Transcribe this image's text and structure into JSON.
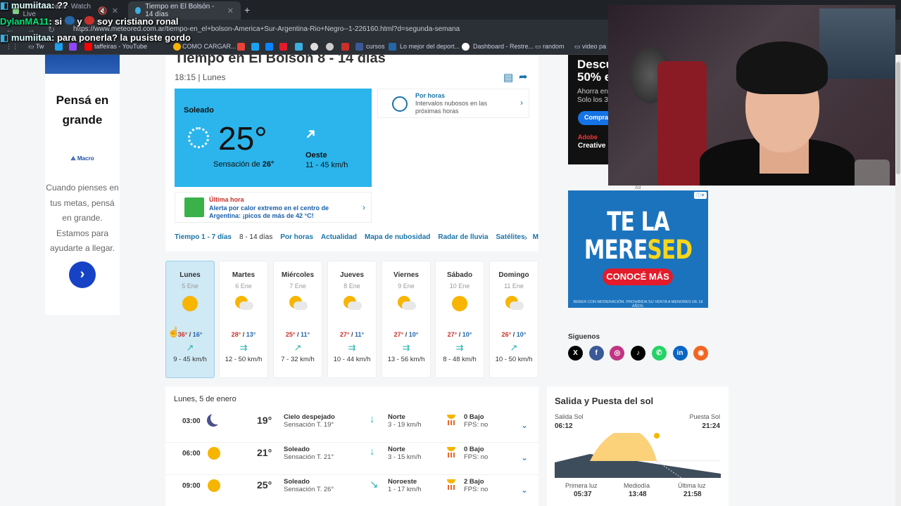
{
  "browser": {
    "tabs": [
      {
        "title": "Tama Stream - Watch Live"
      },
      {
        "title": "Tiempo en El Bolsón - 14 días"
      }
    ],
    "new_tab": "+",
    "url": "https://www.meteored.com.ar/tiempo-en_el+bolson-America+Sur-Argentina-Rio+Negro--1-226160.html?d=segunda-semana",
    "bookmarks": [
      "Tw",
      "taffeiras - YouTube",
      "COMO CARGAR...",
      "cursos",
      "Lo mejor del deport...",
      "Dashboard - Restre...",
      "random",
      "video pa"
    ]
  },
  "chat": [
    {
      "user": "mumiitaa",
      "text": ": ??"
    },
    {
      "user": "DylanMA11",
      "text": ": si",
      "text2": "y",
      "text3": "soy cristiano ronal"
    },
    {
      "user": "mumiitaa",
      "text": ": para ponerla? la pusiste gordo"
    }
  ],
  "left_ad": {
    "headline": "Pensá en grande",
    "brand": "Macro",
    "body": "Cuando pienses en tus metas, pensá en grande. Estamos para ayudarte a llegar.",
    "arrow": "›"
  },
  "page": {
    "title": "Tiempo en El Bolsón 8 - 14 días",
    "time_line": "18:15 | Lunes",
    "current": {
      "condition": "Soleado",
      "temperature": "25°",
      "feels_label": "Sensación de ",
      "feels_value": "26°",
      "wind_dir": "Oeste",
      "wind_speed": "11 - 45 km/h"
    },
    "por_horas": {
      "title": "Por horas",
      "text": "Intervalos nubosos en las próximas horas"
    },
    "news": {
      "tag": "Última hora",
      "headline": "Alerta por calor extremo en el centro de Argentina: ¡picos de más de 42 °C!"
    },
    "subnav": [
      "Tiempo 1 - 7 días",
      "8 - 14 días",
      "Por horas",
      "Actualidad",
      "Mapa de nubosidad",
      "Radar de lluvia",
      "Satélites",
      "M"
    ],
    "days": [
      {
        "name": "Lunes",
        "date": "5 Ene",
        "icon": "sun-icon",
        "hi": "36°",
        "lo": "16°",
        "wind": "9 - 45 km/h",
        "arrow": "↗",
        "selected": true
      },
      {
        "name": "Martes",
        "date": "6 Ene",
        "icon": "partly-cloudy-icon",
        "hi": "28°",
        "lo": "13°",
        "wind": "12 - 50 km/h",
        "arrow": "⇉"
      },
      {
        "name": "Miércoles",
        "date": "7 Ene",
        "icon": "partly-cloudy-icon",
        "hi": "25°",
        "lo": "11°",
        "wind": "7 - 32 km/h",
        "arrow": "↗"
      },
      {
        "name": "Jueves",
        "date": "8 Ene",
        "icon": "partly-cloudy-icon",
        "hi": "27°",
        "lo": "11°",
        "wind": "10 - 44 km/h",
        "arrow": "⇉"
      },
      {
        "name": "Viernes",
        "date": "9 Ene",
        "icon": "partly-cloudy-icon",
        "hi": "27°",
        "lo": "10°",
        "wind": "13 - 56 km/h",
        "arrow": "⇉"
      },
      {
        "name": "Sábado",
        "date": "10 Ene",
        "icon": "sun-icon",
        "hi": "27°",
        "lo": "10°",
        "wind": "8 - 48 km/h",
        "arrow": "⇉"
      },
      {
        "name": "Domingo",
        "date": "11 Ene",
        "icon": "partly-cloudy-icon",
        "hi": "26°",
        "lo": "10°",
        "wind": "10 - 50 km/h",
        "arrow": "↗"
      }
    ],
    "hourly": {
      "heading": "Lunes, 5 de enero",
      "rows": [
        {
          "time": "03:00",
          "icon": "moon-icon",
          "temp": "19°",
          "cond": "Cielo despejado",
          "feels": "Sensación T. 19°",
          "wind_dir": "Norte",
          "wind": "3 - 19 km/h",
          "uv": "0 Bajo",
          "fps": "FPS: no",
          "arrow": "↓"
        },
        {
          "time": "06:00",
          "icon": "sun-icon",
          "temp": "21°",
          "cond": "Soleado",
          "feels": "Sensación T. 21°",
          "wind_dir": "Norte",
          "wind": "3 - 15 km/h",
          "uv": "0 Bajo",
          "fps": "FPS: no",
          "arrow": "↓"
        },
        {
          "time": "09:00",
          "icon": "sun-icon",
          "temp": "25°",
          "cond": "Soleado",
          "feels": "Sensación T. 26°",
          "wind_dir": "Noroeste",
          "wind": "1 - 17 km/h",
          "uv": "2 Bajo",
          "fps": "FPS: no",
          "arrow": "↘"
        }
      ]
    },
    "sun": {
      "title": "Salida y Puesta del sol",
      "sunrise_label": "Salida Sol",
      "sunrise": "06:12",
      "sunset_label": "Puesta Sol",
      "sunset": "21:24",
      "first_light_label": "Primera luz",
      "first_light": "05:37",
      "noon_label": "Mediodía",
      "noon": "13:48",
      "last_light_label": "Última luz",
      "last_light": "21:58"
    }
  },
  "right_ads": {
    "adobe": {
      "l1": "Descu",
      "l2": "50% e",
      "l3": "Ahorra en",
      "l4": "Solo los 3",
      "btn": "Compra",
      "brand1": "Adobe",
      "brand2": "Creative"
    },
    "ad_label": "Ad",
    "beer": {
      "line1": "TE LA",
      "line2a": "MERE",
      "line2b": "SED",
      "button": "CONOCÉ MÁS",
      "fine": "BEBER CON MODERACIÓN. PROHIBIDA SU VENTA A MENORES DE 18 AÑOS."
    }
  },
  "social": {
    "heading": "Siguenos",
    "networks": [
      {
        "name": "x",
        "glyph": "X",
        "color": "#000000"
      },
      {
        "name": "facebook",
        "glyph": "f",
        "color": "#3b5998"
      },
      {
        "name": "instagram",
        "glyph": "◎",
        "color": "#c13584"
      },
      {
        "name": "tiktok",
        "glyph": "♪",
        "color": "#000000"
      },
      {
        "name": "whatsapp",
        "glyph": "✆",
        "color": "#25d366"
      },
      {
        "name": "linkedin",
        "glyph": "in",
        "color": "#0a66c2"
      },
      {
        "name": "rss",
        "glyph": "◉",
        "color": "#f26522"
      }
    ]
  },
  "colors": {
    "accent": "#1a73a8",
    "current_box": "#2bb5ec",
    "hi_temp": "#c8302a",
    "lo_temp": "#2466a8"
  }
}
